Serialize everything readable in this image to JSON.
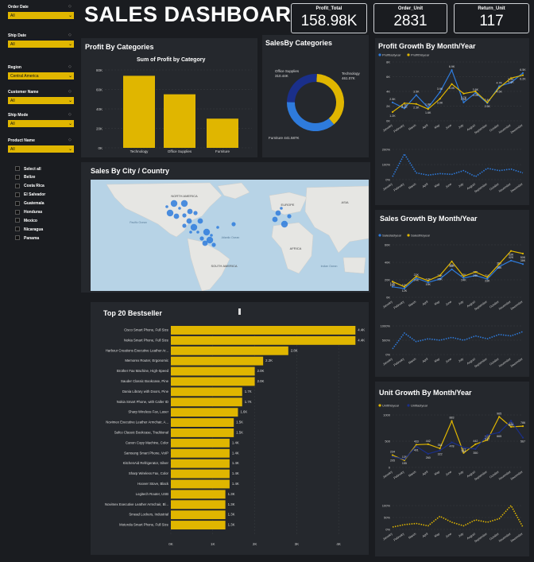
{
  "title": "SALES DASHBOARD",
  "kpis": [
    {
      "label": "Profit_Total",
      "value": "158.98K"
    },
    {
      "label": "Order_Unit",
      "value": "2831"
    },
    {
      "label": "Return_Unit",
      "value": "117"
    }
  ],
  "filters": [
    {
      "label": "Order Date",
      "value": "All"
    },
    {
      "label": "Ship Date",
      "value": "All"
    },
    {
      "label": "Region",
      "value": "Central America"
    },
    {
      "label": "Customer Name",
      "value": "All"
    },
    {
      "label": "Ship Mode",
      "value": "All"
    },
    {
      "label": "Product Name",
      "value": "All"
    }
  ],
  "countries": [
    "Select all",
    "Belize",
    "Costa Rica",
    "El Salvador",
    "Guatemala",
    "Honduras",
    "Mexico",
    "Nicaragua",
    "Panama"
  ],
  "profit_categories": {
    "panel_title": "Profit By Categories",
    "chart_title": "Sum of Profit by Category",
    "y_ticks": [
      "0K",
      "20K",
      "40K",
      "60K",
      "80K"
    ]
  },
  "sales_categories": {
    "panel_title": "SalesBy Categories",
    "labels": [
      "Technology\n461.07K",
      "Office Supplies\n310.44K",
      "Furniture 441.587K"
    ]
  },
  "map": {
    "panel_title": "Sales By City / Country",
    "labels": [
      "NORTH AMERICA",
      "EUROPE",
      "ASIA",
      "AFRICA",
      "SOUTH AMERICA",
      "Pacific Ocean",
      "Atlantic Ocean",
      "Indian Ocean"
    ]
  },
  "top20": {
    "panel_title": "Top 20 Bestseller",
    "x_ticks": [
      "0K",
      "1K",
      "2K",
      "3K",
      "4K"
    ]
  },
  "profit_growth": {
    "panel_title": "Profit Growth By Month/Year",
    "legend": [
      "Profitlastyear",
      "Profitthisyear"
    ],
    "y_ticks": [
      "0K",
      "2K",
      "4K",
      "6K",
      "8K"
    ],
    "pct_ticks": [
      "0%",
      "100%",
      "200%"
    ]
  },
  "sales_growth": {
    "panel_title": "Sales Growth By Month/Year",
    "legend": [
      "Saleslastyear",
      "Salesthisyear"
    ],
    "y_ticks": [
      "0K",
      "20K",
      "40K",
      "60K"
    ],
    "pct_ticks": [
      "0%",
      "500%",
      "1000%"
    ]
  },
  "unit_growth": {
    "panel_title": "Unit Growth By Month/Year",
    "legend": [
      "Unitthisyear",
      "Unitlastyear"
    ],
    "y_ticks": [
      "0",
      "500",
      "1000"
    ],
    "pct_ticks": [
      "0%",
      "50%",
      "100%"
    ]
  },
  "months": [
    "January",
    "February",
    "March",
    "April",
    "May",
    "June",
    "July",
    "August",
    "September",
    "October",
    "November",
    "December"
  ],
  "colors": {
    "gold": "#e0b600",
    "blue": "#2e7bdc",
    "navy": "#1a2f8a",
    "dark": "#1a1c20",
    "panel": "#25282d"
  },
  "chart_data": [
    {
      "type": "bar",
      "title": "Sum of Profit by Category",
      "categories": [
        "Technology",
        "Office Supplies",
        "Furniture"
      ],
      "values": [
        74000,
        55000,
        30000
      ],
      "ylim": [
        0,
        80000
      ]
    },
    {
      "type": "pie",
      "title": "SalesBy Categories",
      "categories": [
        "Technology",
        "Office Supplies",
        "Furniture"
      ],
      "values": [
        461.07,
        310.44,
        441.587
      ]
    },
    {
      "type": "bar",
      "title": "Top 20 Bestseller",
      "orientation": "horizontal",
      "categories": [
        "Cisco Smart Phone, Full Size",
        "Nokia Smart Phone, Full Size",
        "Harbour Creations Executive Leather Ar...",
        "Memorex Router, Ergonomic",
        "Brother Fax Machine, High-Speed",
        "Sauder Classic Bookcase, Pine",
        "Dania Library with Doors, Pine",
        "Nokia Smart Phone, with Caller ID",
        "Sharp Wireless Fax, Laser",
        "Novimex Executive Leather Armchair, A...",
        "Safco Classic Bookcase, Traditional",
        "Canon Copy Machine, Color",
        "Samsung Smart Phone, VoIP",
        "KitchenAid Refrigerator, Silver",
        "Sharp Wireless Fax, Color",
        "Hoover Stove, Black",
        "Logitech Router, USB",
        "Novimex Executive Leather Armchair, Bl...",
        "Smead Lockers, Industrial",
        "Motorola Smart Phone, Full Size"
      ],
      "values": [
        4400,
        4400,
        2800,
        2200,
        2000,
        2000,
        1700,
        1700,
        1600,
        1500,
        1500,
        1400,
        1400,
        1400,
        1400,
        1400,
        1300,
        1300,
        1300,
        1300
      ],
      "labels": [
        "4.4K",
        "4.4K",
        "2.8K",
        "2.2K",
        "2.0K",
        "2.0K",
        "1.7K",
        "1.7K",
        "1.6K",
        "1.5K",
        "1.5K",
        "1.4K",
        "1.4K",
        "1.4K",
        "1.4K",
        "1.4K",
        "1.3K",
        "1.3K",
        "1.3K",
        "1.3K"
      ],
      "xlim": [
        0,
        4500
      ]
    },
    {
      "type": "line",
      "title": "Profit Growth By Month/Year",
      "categories": [
        "January",
        "February",
        "March",
        "April",
        "May",
        "June",
        "July",
        "August",
        "September",
        "October",
        "November",
        "December"
      ],
      "series": [
        {
          "name": "Profitlastyear",
          "values": [
            2.5,
            1.7,
            3.5,
            1.8,
            3.9,
            6.9,
            2.5,
            3.8,
            2.4,
            4.7,
            5.2,
            6.5
          ]
        },
        {
          "name": "Profitthisyear",
          "values": [
            1.2,
            2.4,
            2.3,
            1.6,
            3.0,
            5.0,
            3.7,
            4.0,
            2.5,
            4.5,
            5.8,
            6.2
          ]
        }
      ],
      "ylim": [
        0,
        8
      ]
    },
    {
      "type": "line",
      "title": "Profit Growth By Month/Year (%)",
      "categories": [
        "January",
        "February",
        "March",
        "April",
        "May",
        "June",
        "July",
        "August",
        "September",
        "October",
        "November",
        "December"
      ],
      "values": [
        20,
        170,
        45,
        30,
        40,
        35,
        60,
        20,
        75,
        60,
        70,
        45
      ],
      "ylim": [
        0,
        200
      ]
    },
    {
      "type": "line",
      "title": "Sales Growth By Month/Year",
      "categories": [
        "January",
        "February",
        "March",
        "April",
        "May",
        "June",
        "July",
        "August",
        "September",
        "October",
        "November",
        "December"
      ],
      "series": [
        {
          "name": "Saleslastyear",
          "values": [
            12,
            10,
            22,
            17,
            21,
            32,
            22,
            25,
            21,
            35,
            42,
            38
          ]
        },
        {
          "name": "Salesthisyear",
          "values": [
            18,
            12,
            24,
            19,
            25,
            41,
            24,
            29,
            23,
            38,
            53,
            50
          ]
        }
      ],
      "ylim": [
        0,
        60
      ]
    },
    {
      "type": "line",
      "title": "Sales Growth By Month/Year (%)",
      "categories": [
        "January",
        "February",
        "March",
        "April",
        "May",
        "June",
        "July",
        "August",
        "September",
        "October",
        "November",
        "December"
      ],
      "values": [
        200,
        750,
        450,
        550,
        500,
        600,
        500,
        650,
        550,
        700,
        650,
        800
      ],
      "ylim": [
        0,
        1000
      ]
    },
    {
      "type": "line",
      "title": "Unit Growth By Month/Year",
      "categories": [
        "January",
        "February",
        "March",
        "April",
        "May",
        "June",
        "July",
        "August",
        "September",
        "October",
        "November",
        "December"
      ],
      "series": [
        {
          "name": "Unitthisyear",
          "values": [
            234,
            136,
            433,
            442,
            361,
            883,
            277,
            442,
            523,
            965,
            773,
            786
          ]
        },
        {
          "name": "Unitlastyear",
          "values": [
            205,
            155,
            401,
            260,
            322,
            478,
            381,
            350,
            617,
            665,
            888,
            567
          ]
        }
      ],
      "ylim": [
        0,
        1000
      ]
    },
    {
      "type": "line",
      "title": "Unit Growth By Month/Year (%)",
      "categories": [
        "January",
        "February",
        "March",
        "April",
        "May",
        "June",
        "July",
        "August",
        "September",
        "October",
        "November",
        "December"
      ],
      "values": [
        10,
        20,
        25,
        15,
        55,
        30,
        15,
        40,
        30,
        45,
        100,
        10
      ],
      "ylim": [
        0,
        100
      ]
    }
  ]
}
